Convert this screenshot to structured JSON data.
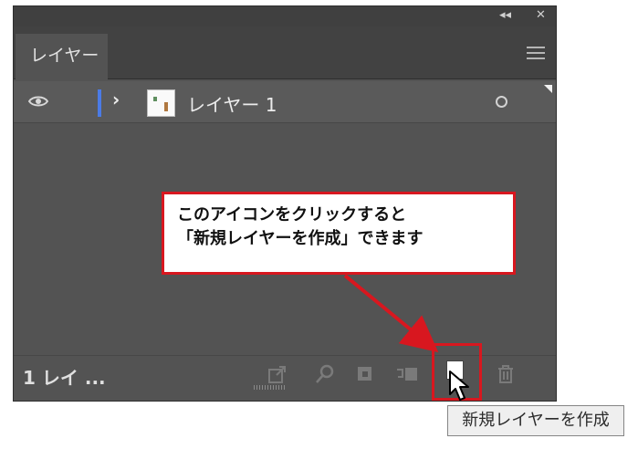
{
  "panel": {
    "collapse_glyph": "◂◂",
    "close_glyph": "✕",
    "tab_label": "レイヤー",
    "menu_icon": "hamburger-menu-icon"
  },
  "layers": [
    {
      "name": "レイヤー 1",
      "visible": true,
      "color": "#4b7be6",
      "expanded": false,
      "target_glyph": "○"
    }
  ],
  "footer": {
    "count_label": "1 レイ ...",
    "buttons": [
      {
        "icon": "collect-for-export-icon"
      },
      {
        "icon": "locate-object-icon"
      },
      {
        "icon": "make-clipping-mask-icon"
      },
      {
        "icon": "create-sublayer-icon"
      },
      {
        "icon": "new-layer-icon"
      },
      {
        "icon": "delete-layer-icon"
      }
    ]
  },
  "annotation": {
    "line1": "このアイコンをクリックすると",
    "line2": "「新規レイヤーを作成」できます",
    "border_color": "#d8171f"
  },
  "tooltip": {
    "text": "新規レイヤーを作成"
  }
}
